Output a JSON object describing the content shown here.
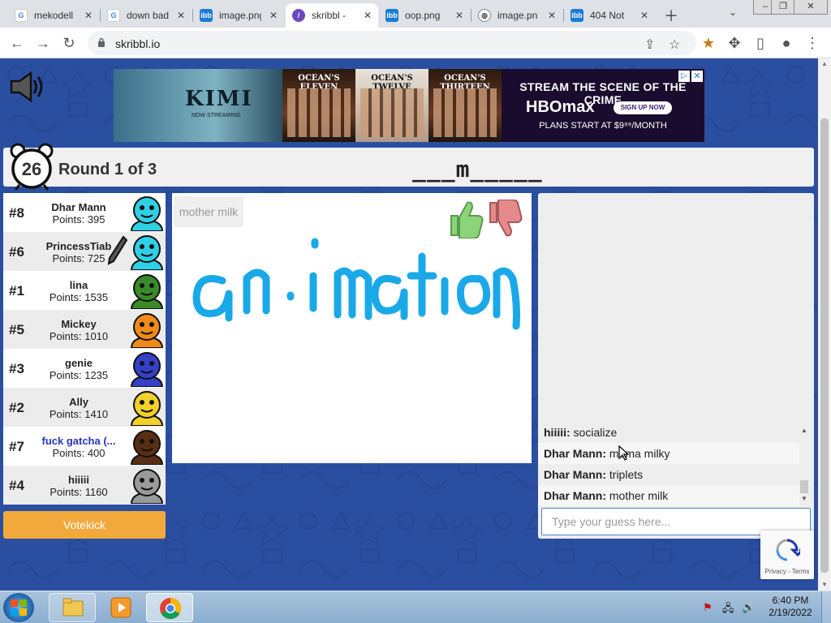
{
  "browser": {
    "tabs": [
      {
        "title": "mekodell",
        "favicon": "google",
        "active": false
      },
      {
        "title": "down bad",
        "favicon": "google",
        "active": false
      },
      {
        "title": "image.png",
        "favicon": "ibb",
        "active": false
      },
      {
        "title": "skribbl -",
        "favicon": "skribbl",
        "active": true
      },
      {
        "title": "oop.png",
        "favicon": "ibb",
        "active": false
      },
      {
        "title": "image.pn",
        "favicon": "globe",
        "active": false
      },
      {
        "title": "404 Not",
        "favicon": "ibb",
        "active": false
      }
    ],
    "url": "skribbl.io"
  },
  "ad": {
    "kimi_title": "KIMI",
    "kimi_sub": "NOW STREAMING",
    "posters": [
      "OCEAN'S ELEVEN",
      "OCEAN'S TWELVE",
      "OCEAN'S THIRTEEN"
    ],
    "line1": "STREAM THE SCENE OF THE CRIME",
    "brand": "HBOmax",
    "cta": "SIGN UP NOW",
    "line3": "PLANS START AT $9⁹⁹/MONTH"
  },
  "game": {
    "timer": "26",
    "round": "Round 1 of 3",
    "word_hint": "___m_____",
    "last_guess": "mother milk",
    "votekick": "Votekick"
  },
  "players": [
    {
      "rank": "#8",
      "name": "Dhar Mann",
      "points": "Points: 395",
      "color": "#2fd0e6",
      "me": false,
      "drawing": false
    },
    {
      "rank": "#6",
      "name": "PrincessTiab",
      "points": "Points: 725",
      "color": "#2fd0e6",
      "me": false,
      "drawing": true
    },
    {
      "rank": "#1",
      "name": "lina",
      "points": "Points: 1535",
      "color": "#3a8a2a",
      "me": false,
      "drawing": false
    },
    {
      "rank": "#5",
      "name": "Mickey",
      "points": "Points: 1010",
      "color": "#f08a1a",
      "me": false,
      "drawing": false
    },
    {
      "rank": "#3",
      "name": "genie",
      "points": "Points: 1235",
      "color": "#3340c8",
      "me": false,
      "drawing": false
    },
    {
      "rank": "#2",
      "name": "Ally",
      "points": "Points: 1410",
      "color": "#f2d12a",
      "me": false,
      "drawing": false
    },
    {
      "rank": "#7",
      "name": "fuck gatcha (...",
      "points": "Points: 400",
      "color": "#5a2e16",
      "me": true,
      "drawing": false
    },
    {
      "rank": "#4",
      "name": "hiiiii",
      "points": "Points: 1160",
      "color": "#9a9a9a",
      "me": false,
      "drawing": false
    }
  ],
  "chat": {
    "messages": [
      {
        "who": "hiiiii:",
        "text": " socialize"
      },
      {
        "who": "Dhar Mann:",
        "text": " moma milky"
      },
      {
        "who": "Dhar Mann:",
        "text": " triplets"
      },
      {
        "who": "Dhar Mann:",
        "text": " mother milk"
      }
    ],
    "placeholder": "Type your guess here..."
  },
  "recaptcha": {
    "label": "Privacy - Terms"
  },
  "taskbar": {
    "time": "6:40 PM",
    "date": "2/19/2022"
  }
}
